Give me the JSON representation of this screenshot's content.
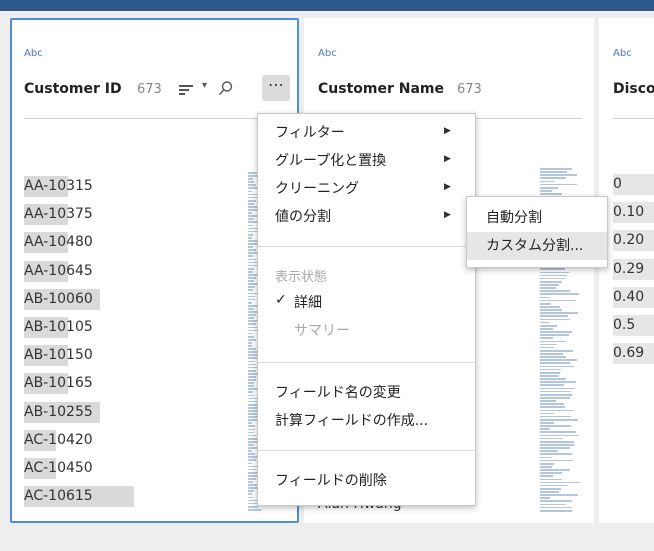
{
  "card1": {
    "type_label": "Abc",
    "field_name": "Customer ID",
    "count": "673",
    "values": [
      "AA-10315",
      "AA-10375",
      "AA-10480",
      "AA-10645",
      "AB-10060",
      "AB-10105",
      "AB-10150",
      "AB-10165",
      "AB-10255",
      "AC-10420",
      "AC-10450",
      "AC-10615"
    ],
    "value_bar_fraction": [
      0.22,
      0.22,
      0.22,
      0.22,
      0.38,
      0.22,
      0.22,
      0.22,
      0.38,
      0.16,
      0.16,
      0.55
    ],
    "more_label": "⋯"
  },
  "card2": {
    "type_label": "Abc",
    "field_name": "Customer Name",
    "count": "673",
    "partial_value": "Alan Hwang"
  },
  "card3": {
    "type_label": "Abc",
    "field_name": "Disco",
    "values": [
      "0",
      "0.10",
      "0.20",
      "0.29",
      "0.40",
      "0.5",
      "0.69"
    ]
  },
  "menu": {
    "filter": "フィルター",
    "group_replace": "グループ化と置換",
    "cleaning": "クリーニング",
    "split_values": "値の分割",
    "view_state": "表示状態",
    "detail": "詳細",
    "summary": "サマリー",
    "rename_field": "フィールド名の変更",
    "create_calc": "計算フィールドの作成...",
    "remove_field": "フィールドの削除",
    "checkmark": "✓"
  },
  "submenu": {
    "auto_split": "自動分割",
    "custom_split": "カスタム分割..."
  },
  "icons": {
    "sort": "sort-icon",
    "search": "search-icon",
    "more": "more-options-icon",
    "submenu_arrow": "chevron-right-icon"
  },
  "colors": {
    "accent": "#4a90d9",
    "type_label": "#4a78c2",
    "bar": "#d9d9d9",
    "hist": "#b3c6dc"
  }
}
